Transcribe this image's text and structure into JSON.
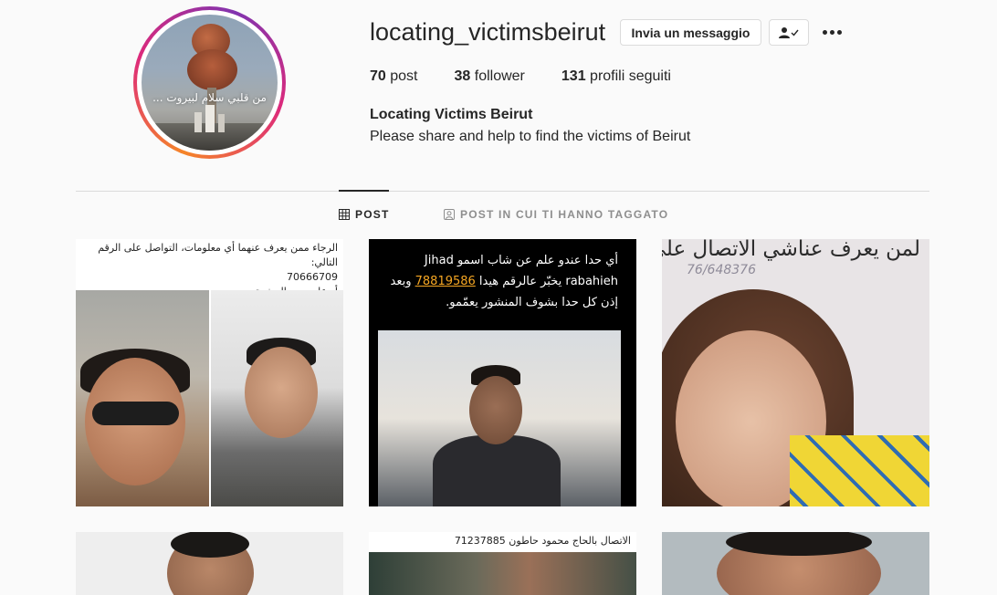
{
  "profile": {
    "username": "locating_victimsbeirut",
    "avatar_caption": "من قلبي سلام لبيروت ...",
    "message_button": "Invia un messaggio",
    "follow_icon": "person-check-icon",
    "more_icon": "more-horizontal-icon",
    "stats": {
      "posts_count": "70",
      "posts_label": "post",
      "followers_count": "38",
      "followers_label": "follower",
      "following_count": "131",
      "following_label": "profili seguiti"
    },
    "full_name": "Locating Victims Beirut",
    "bio": "Please share and help to find the victims of Beirut"
  },
  "tabs": [
    {
      "label": "POST",
      "icon": "grid-icon",
      "active": true
    },
    {
      "label": "POST IN CUI TI HANNO TAGGATO",
      "icon": "tagged-icon",
      "active": false
    }
  ],
  "posts": [
    {
      "lines": [
        "الرجاء ممن يعرف عنهما أي معلومات، التواصل على الرقم التالي:",
        "70666709",
        "أو على بريد الصفحة"
      ]
    },
    {
      "line1": "أي حدا عندو علم عن شاب اسمو Jihad",
      "line2_a": "rabahieh يخبّر عالرقم هيدا ",
      "line2_num": "78819586",
      "line2_b": " وبعد",
      "line3": "إذن كل حدا بشوف المنشور يعمّمو."
    },
    {
      "title": "لمن يعرف عناشي الاتصال على",
      "phone": "76/648376"
    },
    {},
    {
      "text": "الاتصال بالحاج محمود حاطون 71237885"
    },
    {}
  ]
}
